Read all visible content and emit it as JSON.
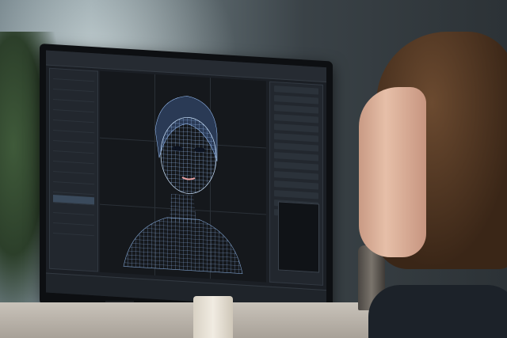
{
  "scene": {
    "description_icon": "photo-scene",
    "colors": {
      "screen_bg": "#1b1f25",
      "wireframe": "#cfe6ff",
      "panel": "#22272e",
      "selection": "#3a4a5c"
    }
  },
  "app": {
    "window_title": "",
    "left_panel_items": 16,
    "right_panel_rows": 14
  }
}
